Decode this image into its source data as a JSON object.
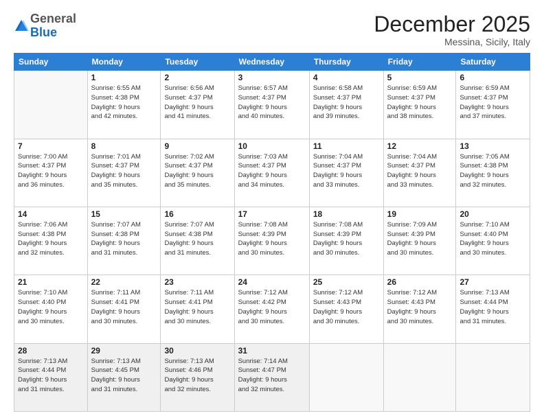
{
  "header": {
    "logo_general": "General",
    "logo_blue": "Blue",
    "month_title": "December 2025",
    "location": "Messina, Sicily, Italy"
  },
  "days_of_week": [
    "Sunday",
    "Monday",
    "Tuesday",
    "Wednesday",
    "Thursday",
    "Friday",
    "Saturday"
  ],
  "weeks": [
    [
      {
        "day": "",
        "info": ""
      },
      {
        "day": "1",
        "info": "Sunrise: 6:55 AM\nSunset: 4:38 PM\nDaylight: 9 hours\nand 42 minutes."
      },
      {
        "day": "2",
        "info": "Sunrise: 6:56 AM\nSunset: 4:37 PM\nDaylight: 9 hours\nand 41 minutes."
      },
      {
        "day": "3",
        "info": "Sunrise: 6:57 AM\nSunset: 4:37 PM\nDaylight: 9 hours\nand 40 minutes."
      },
      {
        "day": "4",
        "info": "Sunrise: 6:58 AM\nSunset: 4:37 PM\nDaylight: 9 hours\nand 39 minutes."
      },
      {
        "day": "5",
        "info": "Sunrise: 6:59 AM\nSunset: 4:37 PM\nDaylight: 9 hours\nand 38 minutes."
      },
      {
        "day": "6",
        "info": "Sunrise: 6:59 AM\nSunset: 4:37 PM\nDaylight: 9 hours\nand 37 minutes."
      }
    ],
    [
      {
        "day": "7",
        "info": "Sunrise: 7:00 AM\nSunset: 4:37 PM\nDaylight: 9 hours\nand 36 minutes."
      },
      {
        "day": "8",
        "info": "Sunrise: 7:01 AM\nSunset: 4:37 PM\nDaylight: 9 hours\nand 35 minutes."
      },
      {
        "day": "9",
        "info": "Sunrise: 7:02 AM\nSunset: 4:37 PM\nDaylight: 9 hours\nand 35 minutes."
      },
      {
        "day": "10",
        "info": "Sunrise: 7:03 AM\nSunset: 4:37 PM\nDaylight: 9 hours\nand 34 minutes."
      },
      {
        "day": "11",
        "info": "Sunrise: 7:04 AM\nSunset: 4:37 PM\nDaylight: 9 hours\nand 33 minutes."
      },
      {
        "day": "12",
        "info": "Sunrise: 7:04 AM\nSunset: 4:37 PM\nDaylight: 9 hours\nand 33 minutes."
      },
      {
        "day": "13",
        "info": "Sunrise: 7:05 AM\nSunset: 4:38 PM\nDaylight: 9 hours\nand 32 minutes."
      }
    ],
    [
      {
        "day": "14",
        "info": "Sunrise: 7:06 AM\nSunset: 4:38 PM\nDaylight: 9 hours\nand 32 minutes."
      },
      {
        "day": "15",
        "info": "Sunrise: 7:07 AM\nSunset: 4:38 PM\nDaylight: 9 hours\nand 31 minutes."
      },
      {
        "day": "16",
        "info": "Sunrise: 7:07 AM\nSunset: 4:38 PM\nDaylight: 9 hours\nand 31 minutes."
      },
      {
        "day": "17",
        "info": "Sunrise: 7:08 AM\nSunset: 4:39 PM\nDaylight: 9 hours\nand 30 minutes."
      },
      {
        "day": "18",
        "info": "Sunrise: 7:08 AM\nSunset: 4:39 PM\nDaylight: 9 hours\nand 30 minutes."
      },
      {
        "day": "19",
        "info": "Sunrise: 7:09 AM\nSunset: 4:39 PM\nDaylight: 9 hours\nand 30 minutes."
      },
      {
        "day": "20",
        "info": "Sunrise: 7:10 AM\nSunset: 4:40 PM\nDaylight: 9 hours\nand 30 minutes."
      }
    ],
    [
      {
        "day": "21",
        "info": "Sunrise: 7:10 AM\nSunset: 4:40 PM\nDaylight: 9 hours\nand 30 minutes."
      },
      {
        "day": "22",
        "info": "Sunrise: 7:11 AM\nSunset: 4:41 PM\nDaylight: 9 hours\nand 30 minutes."
      },
      {
        "day": "23",
        "info": "Sunrise: 7:11 AM\nSunset: 4:41 PM\nDaylight: 9 hours\nand 30 minutes."
      },
      {
        "day": "24",
        "info": "Sunrise: 7:12 AM\nSunset: 4:42 PM\nDaylight: 9 hours\nand 30 minutes."
      },
      {
        "day": "25",
        "info": "Sunrise: 7:12 AM\nSunset: 4:43 PM\nDaylight: 9 hours\nand 30 minutes."
      },
      {
        "day": "26",
        "info": "Sunrise: 7:12 AM\nSunset: 4:43 PM\nDaylight: 9 hours\nand 30 minutes."
      },
      {
        "day": "27",
        "info": "Sunrise: 7:13 AM\nSunset: 4:44 PM\nDaylight: 9 hours\nand 31 minutes."
      }
    ],
    [
      {
        "day": "28",
        "info": "Sunrise: 7:13 AM\nSunset: 4:44 PM\nDaylight: 9 hours\nand 31 minutes."
      },
      {
        "day": "29",
        "info": "Sunrise: 7:13 AM\nSunset: 4:45 PM\nDaylight: 9 hours\nand 31 minutes."
      },
      {
        "day": "30",
        "info": "Sunrise: 7:13 AM\nSunset: 4:46 PM\nDaylight: 9 hours\nand 32 minutes."
      },
      {
        "day": "31",
        "info": "Sunrise: 7:14 AM\nSunset: 4:47 PM\nDaylight: 9 hours\nand 32 minutes."
      },
      {
        "day": "",
        "info": ""
      },
      {
        "day": "",
        "info": ""
      },
      {
        "day": "",
        "info": ""
      }
    ]
  ]
}
